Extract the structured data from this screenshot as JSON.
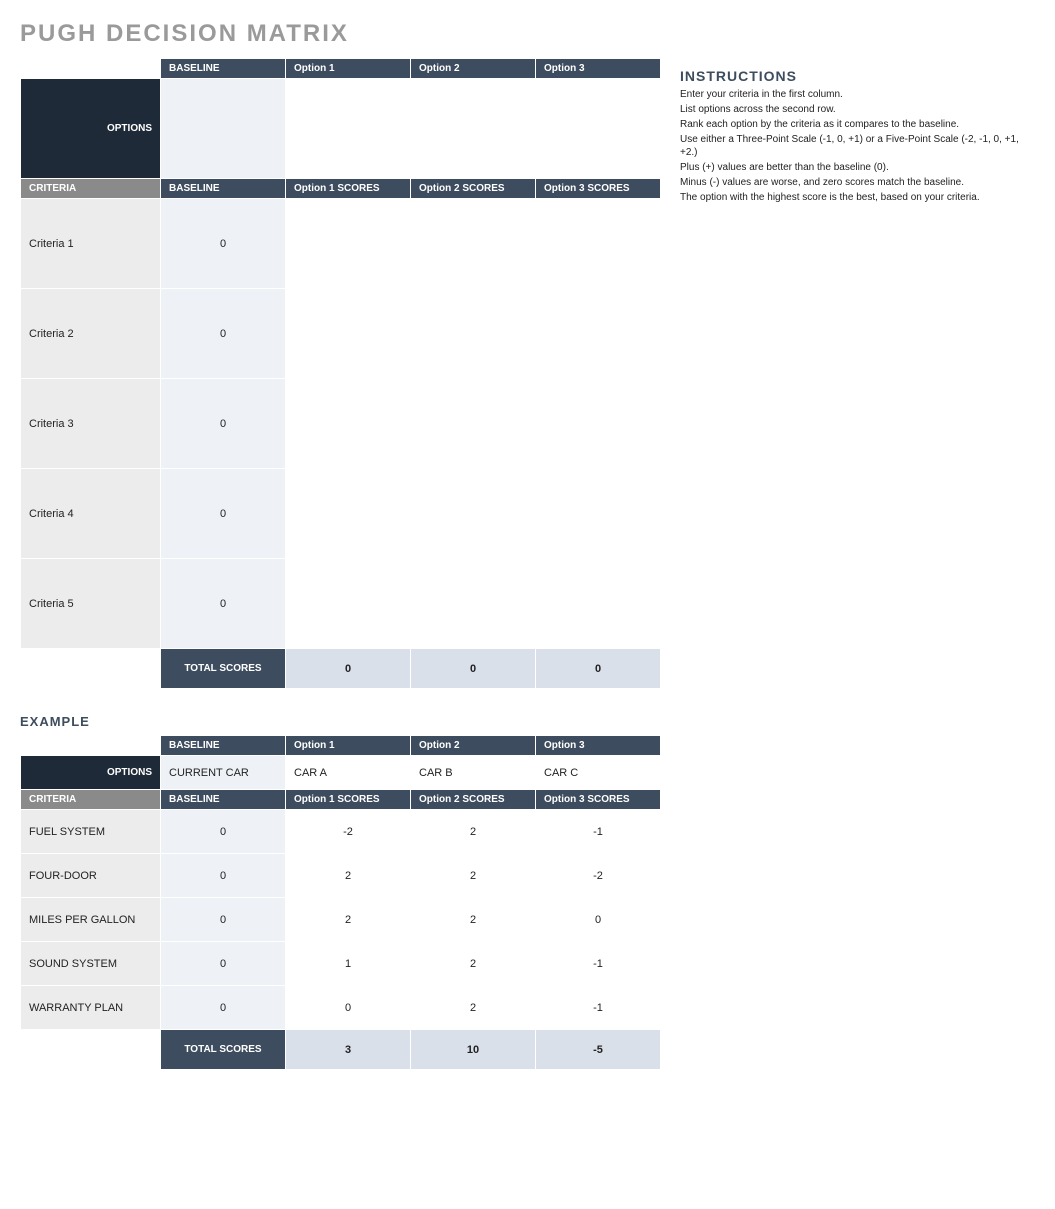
{
  "title": "PUGH DECISION MATRIX",
  "labels": {
    "baseline": "BASELINE",
    "options": "OPTIONS",
    "criteria": "CRITERIA",
    "total_scores": "TOTAL SCORES",
    "example": "EXAMPLE"
  },
  "main": {
    "option_headers": [
      "Option 1",
      "Option 2",
      "Option 3"
    ],
    "option_values": [
      "",
      "",
      ""
    ],
    "score_headers": [
      "Option 1 SCORES",
      "Option 2 SCORES",
      "Option 3 SCORES"
    ],
    "criteria": [
      {
        "name": "Criteria 1",
        "baseline": "0",
        "scores": [
          "",
          "",
          ""
        ]
      },
      {
        "name": "Criteria 2",
        "baseline": "0",
        "scores": [
          "",
          "",
          ""
        ]
      },
      {
        "name": "Criteria 3",
        "baseline": "0",
        "scores": [
          "",
          "",
          ""
        ]
      },
      {
        "name": "Criteria 4",
        "baseline": "0",
        "scores": [
          "",
          "",
          ""
        ]
      },
      {
        "name": "Criteria 5",
        "baseline": "0",
        "scores": [
          "",
          "",
          ""
        ]
      }
    ],
    "totals": [
      "0",
      "0",
      "0"
    ]
  },
  "example": {
    "option_headers": [
      "Option 1",
      "Option 2",
      "Option 3"
    ],
    "option_values": [
      "CURRENT CAR",
      "CAR A",
      "CAR B",
      "CAR C"
    ],
    "score_headers": [
      "Option 1 SCORES",
      "Option 2 SCORES",
      "Option 3 SCORES"
    ],
    "criteria": [
      {
        "name": "FUEL SYSTEM",
        "baseline": "0",
        "scores": [
          "-2",
          "2",
          "-1"
        ]
      },
      {
        "name": "FOUR-DOOR",
        "baseline": "0",
        "scores": [
          "2",
          "2",
          "-2"
        ]
      },
      {
        "name": "MILES PER GALLON",
        "baseline": "0",
        "scores": [
          "2",
          "2",
          "0"
        ]
      },
      {
        "name": "SOUND SYSTEM",
        "baseline": "0",
        "scores": [
          "1",
          "2",
          "-1"
        ]
      },
      {
        "name": "WARRANTY PLAN",
        "baseline": "0",
        "scores": [
          "0",
          "2",
          "-1"
        ]
      }
    ],
    "totals": [
      "3",
      "10",
      "-5"
    ]
  },
  "instructions": {
    "title": "INSTRUCTIONS",
    "lines": [
      "Enter your criteria in the first column.",
      "List options across the second row.",
      "Rank each option by the criteria as it compares to the baseline.",
      "Use either a Three-Point Scale (-1, 0, +1) or a Five-Point Scale (-2, -1, 0, +1, +2.)",
      "Plus (+) values are better than the baseline (0).",
      "Minus (-) values are worse, and zero scores match the baseline.",
      "The option with the highest score is the best, based on your criteria."
    ]
  }
}
